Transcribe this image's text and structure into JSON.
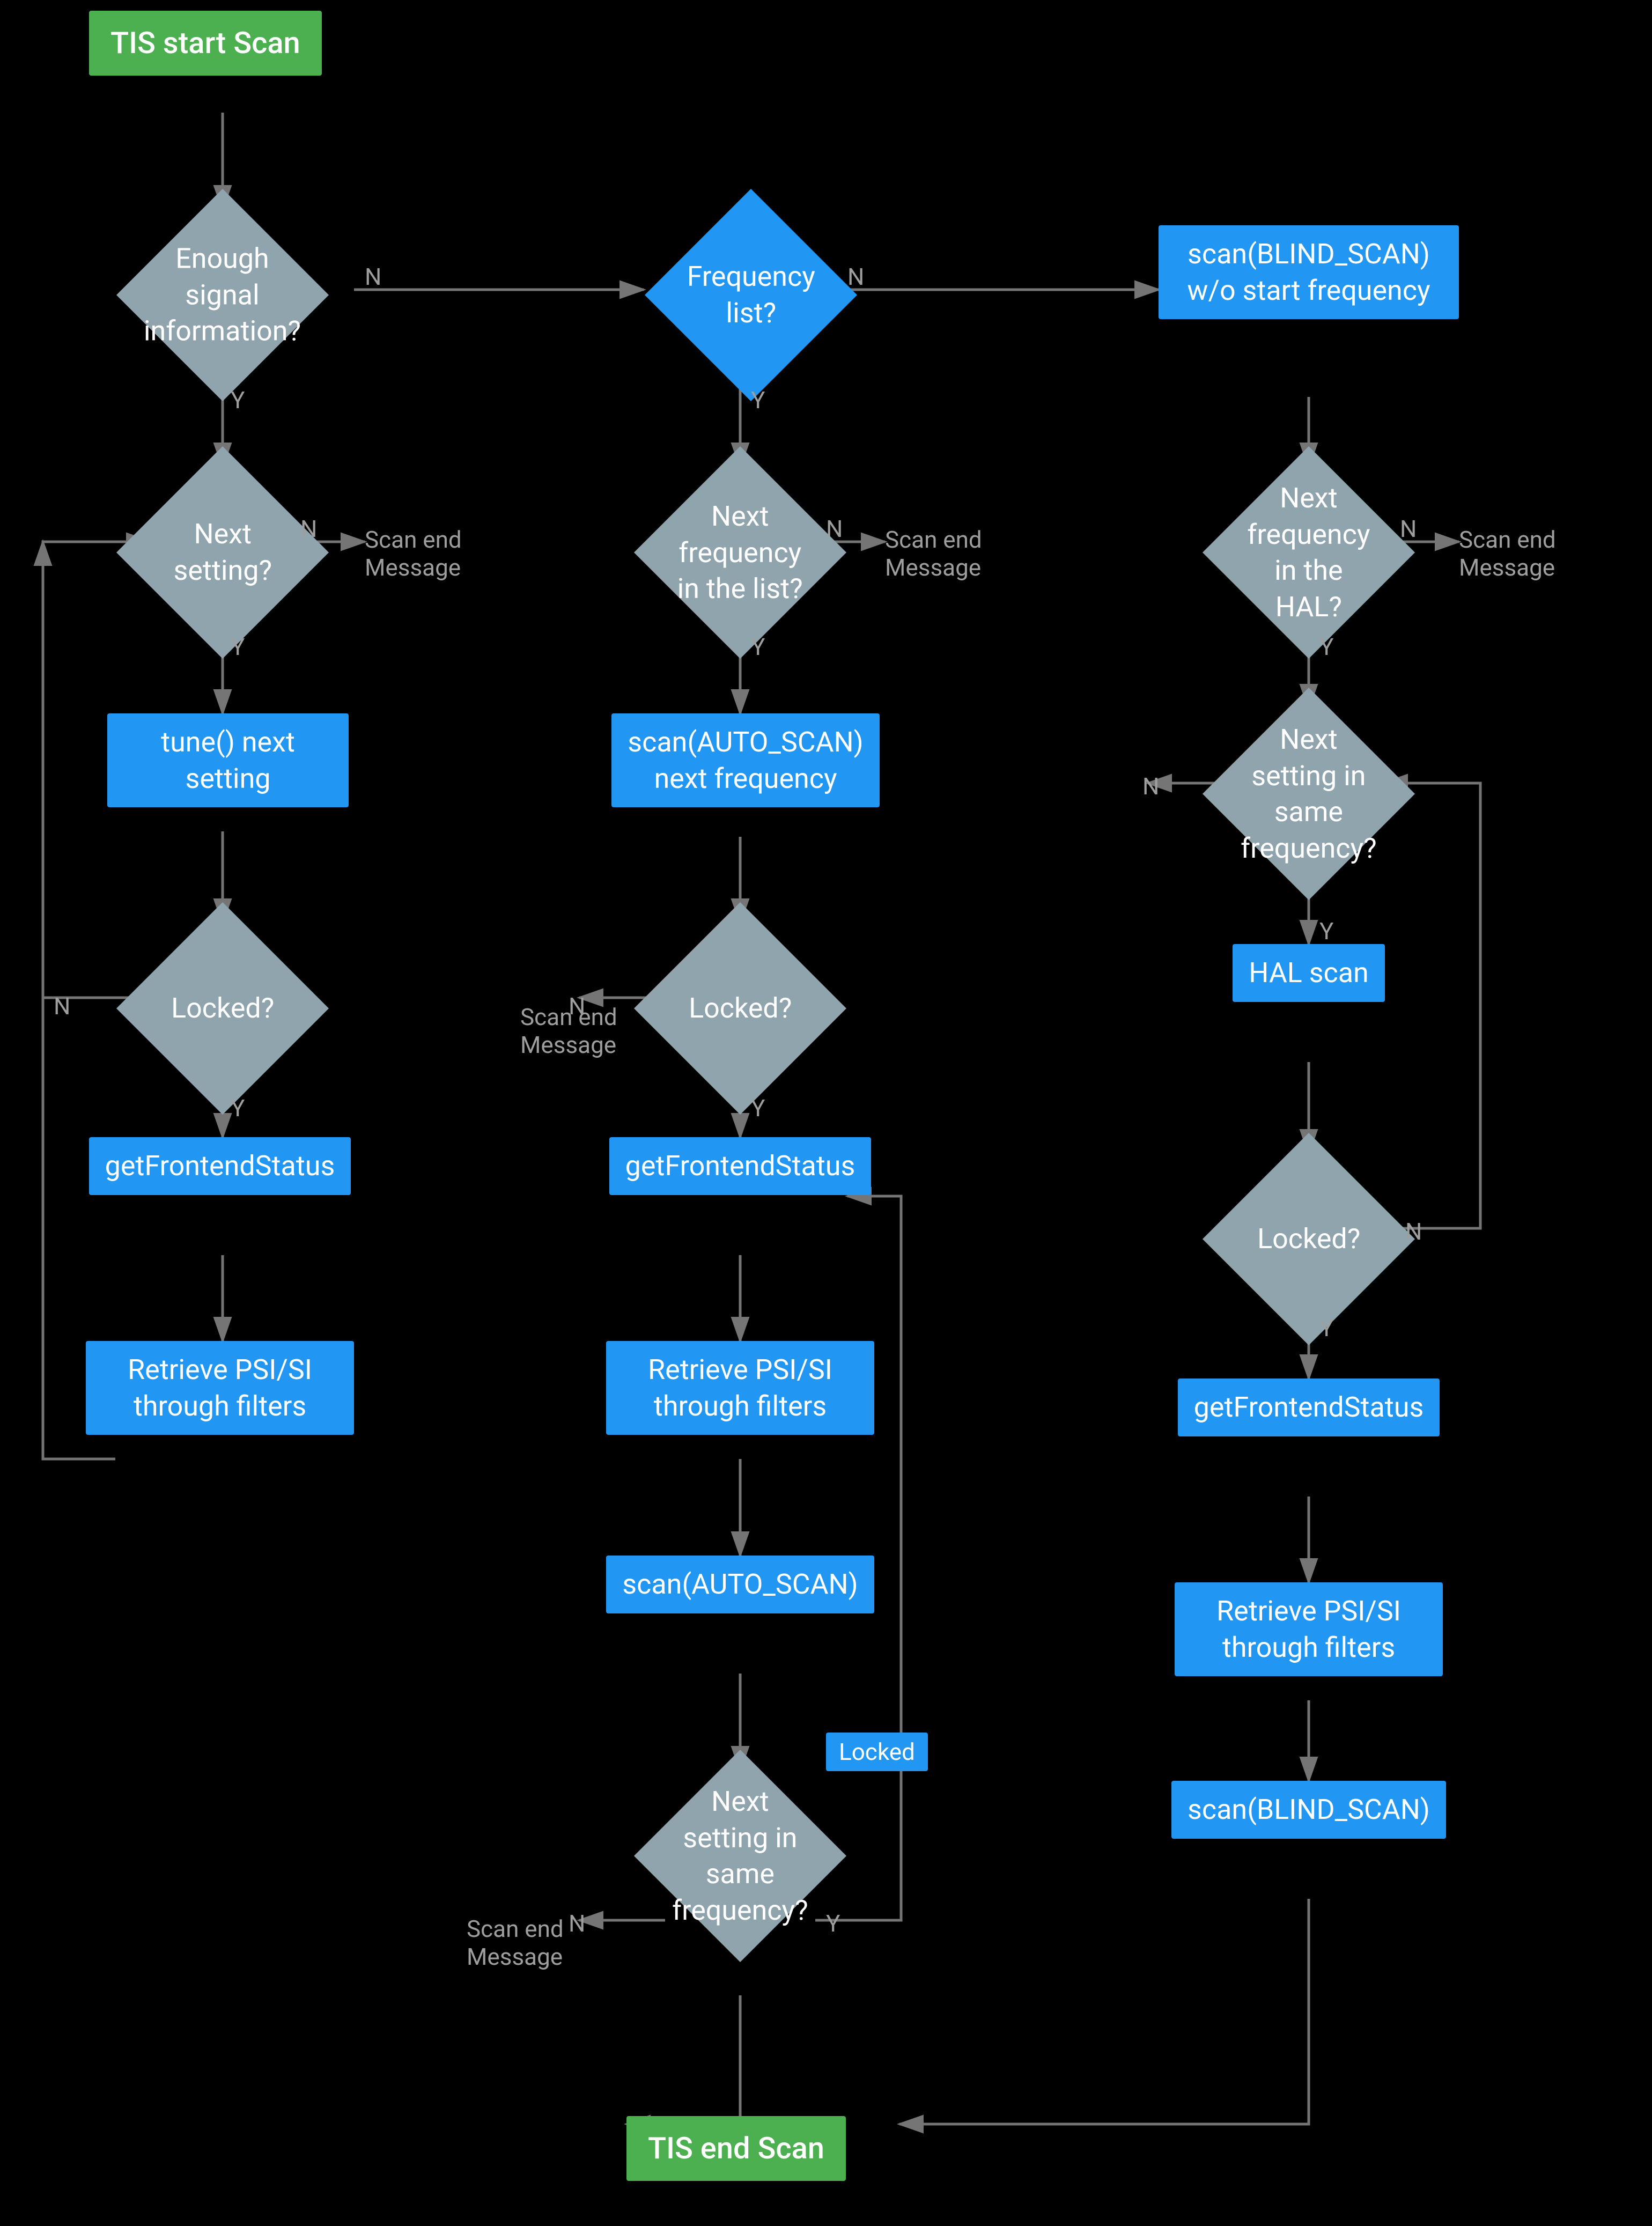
{
  "nodes": {
    "start": {
      "label": "TIS start Scan"
    },
    "end": {
      "label": "TIS end Scan"
    },
    "enough_signal": {
      "label": "Enough signal\ninformation?"
    },
    "frequency_list": {
      "label": "Frequency\nlist?"
    },
    "blind_scan_start": {
      "label": "scan(BLIND_SCAN)\nw/o start frequency"
    },
    "next_setting": {
      "label": "Next setting?"
    },
    "next_freq_list": {
      "label": "Next frequency\nin the list?"
    },
    "next_freq_hal": {
      "label": "Next frequency\nin the HAL?"
    },
    "tune_next": {
      "label": "tune() next setting"
    },
    "scan_auto_next": {
      "label": "scan(AUTO_SCAN)\nnext frequency"
    },
    "next_setting_same_freq": {
      "label": "Next setting in\nsame frequency?"
    },
    "locked1": {
      "label": "Locked?"
    },
    "locked2": {
      "label": "Locked?"
    },
    "locked3": {
      "label": "Locked?"
    },
    "locked_badge": {
      "label": "Locked"
    },
    "get_frontend1": {
      "label": "getFrontendStatus"
    },
    "get_frontend2": {
      "label": "getFrontendStatus"
    },
    "get_frontend3": {
      "label": "getFrontendStatus"
    },
    "retrieve_psi1": {
      "label": "Retrieve PSI/SI\nthrough filters"
    },
    "retrieve_psi2": {
      "label": "Retrieve PSI/SI\nthrough filters"
    },
    "retrieve_psi3": {
      "label": "Retrieve PSI/SI\nthrough filters"
    },
    "scan_auto": {
      "label": "scan(AUTO_SCAN)"
    },
    "next_setting_same_freq2": {
      "label": "Next setting in\nsame frequency?"
    },
    "hal_scan": {
      "label": "HAL scan"
    },
    "blind_scan": {
      "label": "scan(BLIND_SCAN)"
    },
    "scan_end_msg1": {
      "label": "Scan end\nMessage"
    },
    "scan_end_msg2": {
      "label": "Scan end\nMessage"
    },
    "scan_end_msg3": {
      "label": "Scan end\nMessage"
    },
    "scan_end_msg4": {
      "label": "Scan end\nMessage"
    }
  },
  "labels": {
    "n": "N",
    "y": "Y"
  }
}
